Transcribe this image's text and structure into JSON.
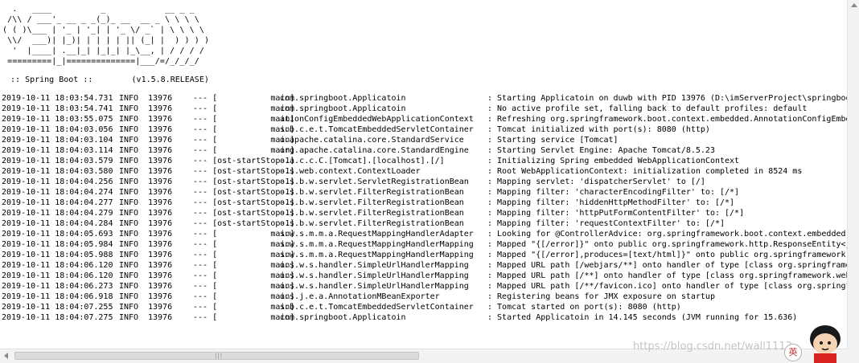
{
  "banner": {
    "ascii_art": "  .   ____          _            __ _ _\n /\\\\ / ___'_ __ _ _(_)_ __  __ _ \\ \\ \\ \\\n( ( )\\___ | '_ | '_| | '_ \\/ _` | \\ \\ \\ \\\n \\\\/  ___)| |_)| | | | | || (_| |  ) ) ) )\n  '  |____| .__|_| |_|_| |_\\__, | / / / /\n =========|_|==============|___/=/_/_/_/",
    "version_line": " :: Spring Boot ::        (v1.5.8.RELEASE)"
  },
  "log": [
    {
      "ts": "2019-10-11 18:03:54.731",
      "level": "INFO",
      "pid": "13976",
      "thread": "--- [           main]",
      "logger": "com.springboot.Applicatoin",
      "message": ": Starting Applicatoin on duwb with PID 13976 (D:\\imServerProject\\springboot"
    },
    {
      "ts": "2019-10-11 18:03:54.741",
      "level": "INFO",
      "pid": "13976",
      "thread": "--- [           main]",
      "logger": "com.springboot.Applicatoin",
      "message": ": No active profile set, falling back to default profiles: default"
    },
    {
      "ts": "2019-10-11 18:03:55.075",
      "level": "INFO",
      "pid": "13976",
      "thread": "--- [           main]",
      "logger": "ationConfigEmbeddedWebApplicationContext",
      "message": ": Refreshing org.springframework.boot.context.embedded.AnnotationConfigEmbed"
    },
    {
      "ts": "2019-10-11 18:04:03.056",
      "level": "INFO",
      "pid": "13976",
      "thread": "--- [           main]",
      "logger": "s.b.c.e.t.TomcatEmbeddedServletContainer",
      "message": ": Tomcat initialized with port(s): 8080 (http)"
    },
    {
      "ts": "2019-10-11 18:04:03.104",
      "level": "INFO",
      "pid": "13976",
      "thread": "--- [           main]",
      "logger": "o.apache.catalina.core.StandardService",
      "message": ": Starting service [Tomcat]"
    },
    {
      "ts": "2019-10-11 18:04:03.114",
      "level": "INFO",
      "pid": "13976",
      "thread": "--- [           main]",
      "logger": "org.apache.catalina.core.StandardEngine",
      "message": ": Starting Servlet Engine: Apache Tomcat/8.5.23"
    },
    {
      "ts": "2019-10-11 18:04:03.579",
      "level": "INFO",
      "pid": "13976",
      "thread": "--- [ost-startStop-1]",
      "logger": "o.a.c.c.C.[Tomcat].[localhost].[/]",
      "message": ": Initializing Spring embedded WebApplicationContext"
    },
    {
      "ts": "2019-10-11 18:04:03.580",
      "level": "INFO",
      "pid": "13976",
      "thread": "--- [ost-startStop-1]",
      "logger": "o.s.web.context.ContextLoader",
      "message": ": Root WebApplicationContext: initialization completed in 8524 ms"
    },
    {
      "ts": "2019-10-11 18:04:04.256",
      "level": "INFO",
      "pid": "13976",
      "thread": "--- [ost-startStop-1]",
      "logger": "o.s.b.w.servlet.ServletRegistrationBean",
      "message": ": Mapping servlet: 'dispatcherServlet' to [/]"
    },
    {
      "ts": "2019-10-11 18:04:04.274",
      "level": "INFO",
      "pid": "13976",
      "thread": "--- [ost-startStop-1]",
      "logger": "o.s.b.w.servlet.FilterRegistrationBean",
      "message": ": Mapping filter: 'characterEncodingFilter' to: [/*]"
    },
    {
      "ts": "2019-10-11 18:04:04.277",
      "level": "INFO",
      "pid": "13976",
      "thread": "--- [ost-startStop-1]",
      "logger": "o.s.b.w.servlet.FilterRegistrationBean",
      "message": ": Mapping filter: 'hiddenHttpMethodFilter' to: [/*]"
    },
    {
      "ts": "2019-10-11 18:04:04.279",
      "level": "INFO",
      "pid": "13976",
      "thread": "--- [ost-startStop-1]",
      "logger": "o.s.b.w.servlet.FilterRegistrationBean",
      "message": ": Mapping filter: 'httpPutFormContentFilter' to: [/*]"
    },
    {
      "ts": "2019-10-11 18:04:04.284",
      "level": "INFO",
      "pid": "13976",
      "thread": "--- [ost-startStop-1]",
      "logger": "o.s.b.w.servlet.FilterRegistrationBean",
      "message": ": Mapping filter: 'requestContextFilter' to: [/*]"
    },
    {
      "ts": "2019-10-11 18:04:05.693",
      "level": "INFO",
      "pid": "13976",
      "thread": "--- [           main]",
      "logger": "s.w.s.m.m.a.RequestMappingHandlerAdapter",
      "message": ": Looking for @ControllerAdvice: org.springframework.boot.context.embedded.A"
    },
    {
      "ts": "2019-10-11 18:04:05.984",
      "level": "INFO",
      "pid": "13976",
      "thread": "--- [           main]",
      "logger": "s.w.s.m.m.a.RequestMappingHandlerMapping",
      "message": ": Mapped \"{[/error]}\" onto public org.springframework.http.ResponseEntity<ja"
    },
    {
      "ts": "2019-10-11 18:04:05.988",
      "level": "INFO",
      "pid": "13976",
      "thread": "--- [           main]",
      "logger": "s.w.s.m.m.a.RequestMappingHandlerMapping",
      "message": ": Mapped \"{[/error],produces=[text/html]}\" onto public org.springframework.w"
    },
    {
      "ts": "2019-10-11 18:04:06.120",
      "level": "INFO",
      "pid": "13976",
      "thread": "--- [           main]",
      "logger": "o.s.w.s.handler.SimpleUrlHandlerMapping",
      "message": ": Mapped URL path [/webjars/**] onto handler of type [class org.springframew"
    },
    {
      "ts": "2019-10-11 18:04:06.120",
      "level": "INFO",
      "pid": "13976",
      "thread": "--- [           main]",
      "logger": "o.s.w.s.handler.SimpleUrlHandlerMapping",
      "message": ": Mapped URL path [/**] onto handler of type [class org.springframework.web."
    },
    {
      "ts": "2019-10-11 18:04:06.273",
      "level": "INFO",
      "pid": "13976",
      "thread": "--- [           main]",
      "logger": "o.s.w.s.handler.SimpleUrlHandlerMapping",
      "message": ": Mapped URL path [/**/favicon.ico] onto handler of type [class org.springfr"
    },
    {
      "ts": "2019-10-11 18:04:06.918",
      "level": "INFO",
      "pid": "13976",
      "thread": "--- [           main]",
      "logger": "o.s.j.e.a.AnnotationMBeanExporter",
      "message": ": Registering beans for JMX exposure on startup"
    },
    {
      "ts": "2019-10-11 18:04:07.255",
      "level": "INFO",
      "pid": "13976",
      "thread": "--- [           main]",
      "logger": "s.b.c.e.t.TomcatEmbeddedServletContainer",
      "message": ": Tomcat started on port(s): 8080 (http)"
    },
    {
      "ts": "2019-10-11 18:04:07.275",
      "level": "INFO",
      "pid": "13976",
      "thread": "--- [           main]",
      "logger": "com.springboot.Applicatoin",
      "message": ": Started Applicatoin in 14.145 seconds (JVM running for 15.636)"
    }
  ],
  "scrollbar": {
    "grip": "|||",
    "left_arrow_icon": "triangle-left-icon",
    "up_arrow_icon": "triangle-up-icon"
  },
  "watermark": {
    "text": "https://blog.csdn.net/wall",
    "suffix": "1112",
    "ime_label": "英"
  }
}
